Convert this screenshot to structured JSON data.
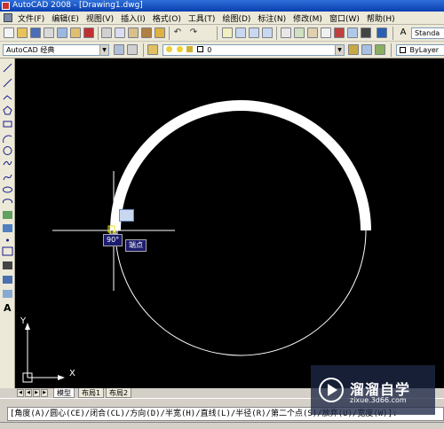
{
  "window": {
    "title": "AutoCAD 2008 - [Drawing1.dwg]"
  },
  "menu": [
    "文件(F)",
    "编辑(E)",
    "视图(V)",
    "插入(I)",
    "格式(O)",
    "工具(T)",
    "绘图(D)",
    "标注(N)",
    "修改(M)",
    "窗口(W)",
    "帮助(H)"
  ],
  "toolbar1": {
    "style_combo": "Standa"
  },
  "toolbar2": {
    "workspace": "AutoCAD 经典",
    "layer": "0",
    "linetype": "ByLayer"
  },
  "canvas": {
    "angle_tooltip": "90°",
    "snap_tooltip": "端点",
    "ucs_x": "X",
    "ucs_y": "Y"
  },
  "layout_tabs": [
    "模型",
    "布局1",
    "布局2"
  ],
  "command_line": "[角度(A)/圆心(CE)/闭合(CL)/方向(D)/半宽(H)/直线(L)/半径(R)/第二个点(S)/放弃(U)/宽度(W)]:",
  "watermark": {
    "name": "溜溜自学",
    "url": "zixue.3d66.com"
  },
  "colors": {
    "canvas": "#000000",
    "title_bar": "#0a3fb0",
    "tooltip": "#1c1c6e",
    "accent": "#d4d0c8"
  }
}
